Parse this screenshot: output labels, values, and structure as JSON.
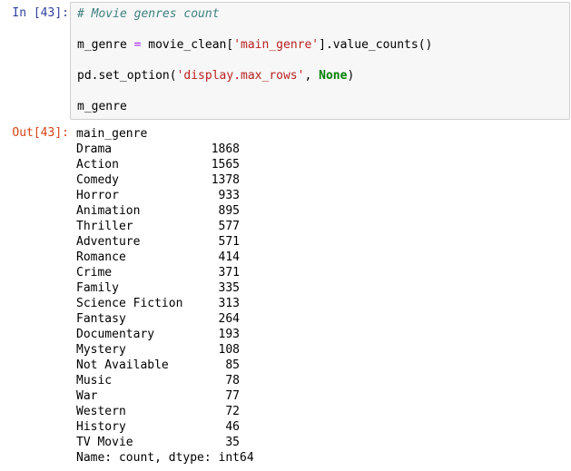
{
  "input_cell": {
    "prompt": "In [43]:",
    "comment": "# Movie genres count",
    "line1": {
      "var": "m_genre",
      "op": "=",
      "pre": " movie_clean[",
      "str": "'main_genre'",
      "post": "].value_counts()"
    },
    "line2": {
      "pre": "pd.set_option(",
      "str": "'display.max_rows'",
      "mid": ", ",
      "kw": "None",
      "post": ")"
    },
    "line3": "m_genre"
  },
  "output_cell": {
    "prompt": "Out[43]:",
    "header": "main_genre",
    "rows": [
      {
        "label": "Drama",
        "value": "1868"
      },
      {
        "label": "Action",
        "value": "1565"
      },
      {
        "label": "Comedy",
        "value": "1378"
      },
      {
        "label": "Horror",
        "value": "933"
      },
      {
        "label": "Animation",
        "value": "895"
      },
      {
        "label": "Thriller",
        "value": "577"
      },
      {
        "label": "Adventure",
        "value": "571"
      },
      {
        "label": "Romance",
        "value": "414"
      },
      {
        "label": "Crime",
        "value": "371"
      },
      {
        "label": "Family",
        "value": "335"
      },
      {
        "label": "Science Fiction",
        "value": "313"
      },
      {
        "label": "Fantasy",
        "value": "264"
      },
      {
        "label": "Documentary",
        "value": "193"
      },
      {
        "label": "Mystery",
        "value": "108"
      },
      {
        "label": "Not Available",
        "value": "85"
      },
      {
        "label": "Music",
        "value": "78"
      },
      {
        "label": "War",
        "value": "77"
      },
      {
        "label": "Western",
        "value": "72"
      },
      {
        "label": "History",
        "value": "46"
      },
      {
        "label": "TV Movie",
        "value": "35"
      }
    ],
    "footer": "Name: count, dtype: int64"
  },
  "colors": {
    "in_prompt": "#303f9f",
    "out_prompt": "#d84315",
    "comment": "#408080",
    "string": "#ba2121",
    "keyword": "#008000",
    "operator": "#aa22ff"
  }
}
